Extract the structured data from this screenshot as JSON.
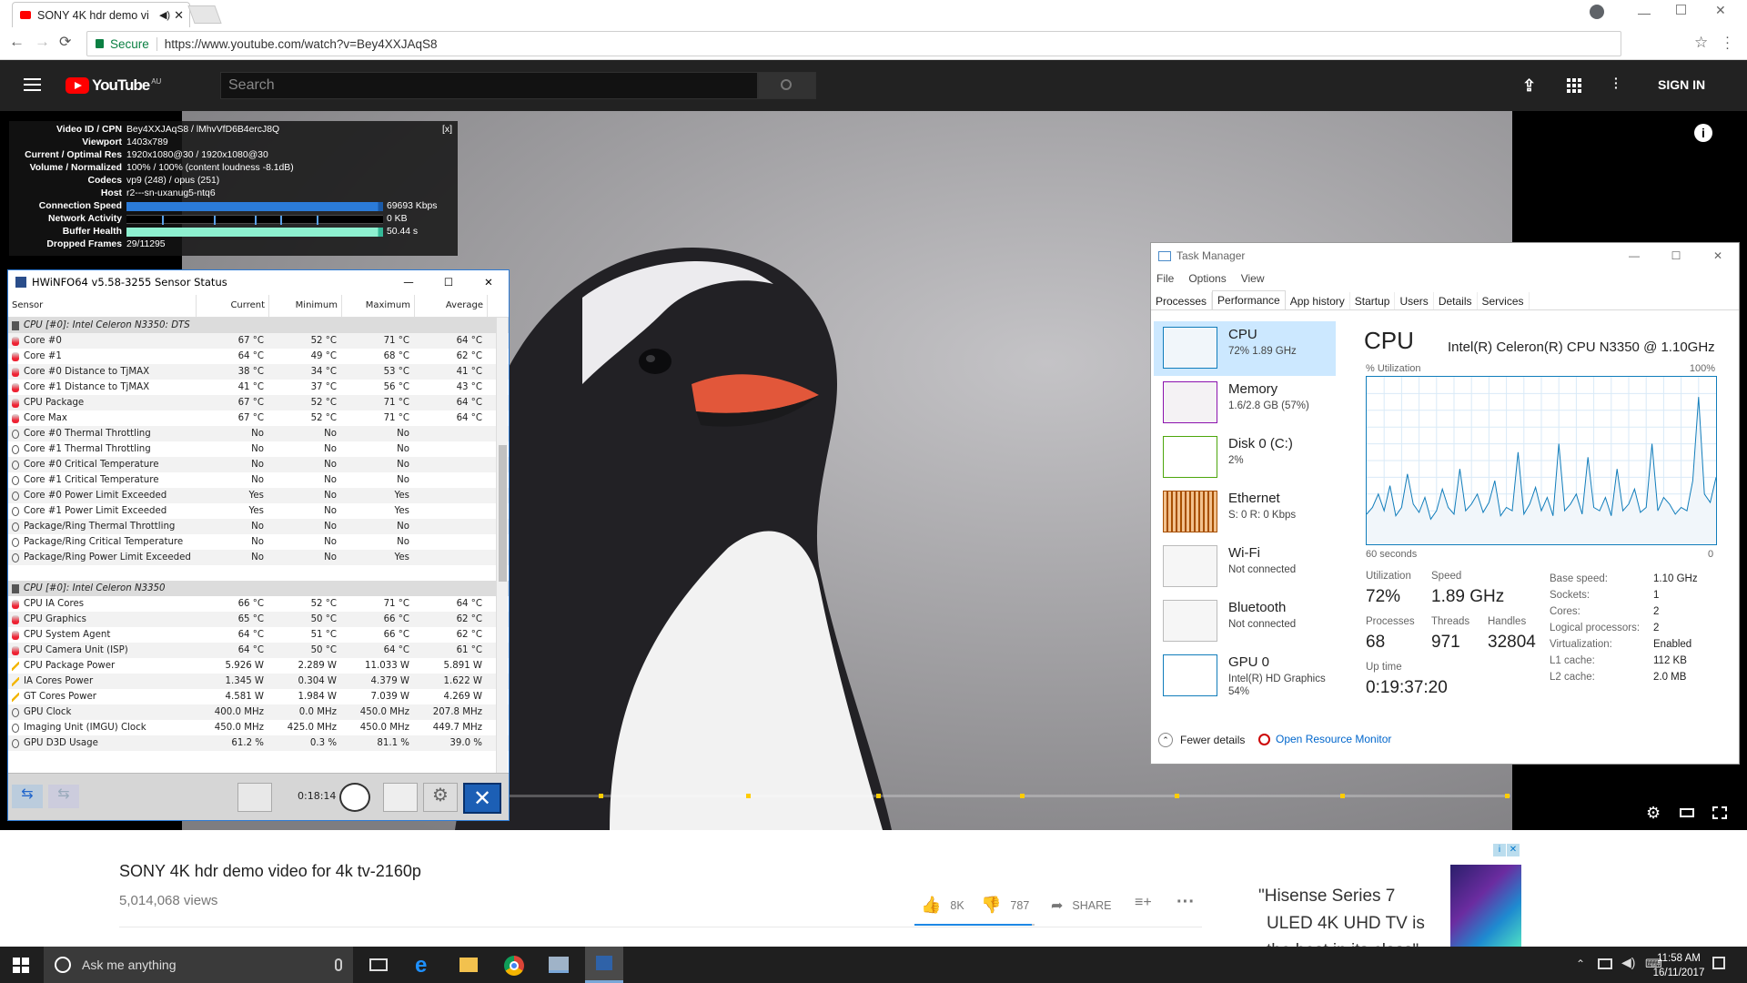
{
  "browser": {
    "tab_title": "SONY 4K hdr demo vi",
    "secure_label": "Secure",
    "url": "https://www.youtube.com/watch?v=Bey4XXJAqS8"
  },
  "youtube": {
    "logo_text": "YouTube",
    "logo_region": "AU",
    "search_placeholder": "Search",
    "sign_in": "SIGN IN",
    "video_title": "SONY 4K hdr demo video for 4k tv-2160p",
    "views": "5,014,068 views",
    "likes": "8K",
    "dislikes": "787",
    "share": "SHARE",
    "ad_text_1": "\"Hisense Series 7",
    "ad_text_2": "ULED 4K UHD TV is",
    "ad_text_3": "the best in its class\""
  },
  "stats_for_nerds": {
    "close": "[x]",
    "rows": [
      {
        "k": "Video ID / CPN",
        "v": "Bey4XXJAqS8 / lMhvVfD6B4ercJ8Q"
      },
      {
        "k": "Viewport",
        "v": "1403x789"
      },
      {
        "k": "Current / Optimal Res",
        "v": "1920x1080@30 / 1920x1080@30"
      },
      {
        "k": "Volume / Normalized",
        "v": "100% / 100% (content loudness -8.1dB)"
      },
      {
        "k": "Codecs",
        "v": "vp9 (248) / opus (251)"
      },
      {
        "k": "Host",
        "v": "r2---sn-uxanug5-ntq6"
      }
    ],
    "bars": [
      {
        "k": "Connection Speed",
        "v": "69693 Kbps"
      },
      {
        "k": "Network Activity",
        "v": "0 KB"
      },
      {
        "k": "Buffer Health",
        "v": "50.44 s"
      }
    ],
    "dropped_label": "Dropped Frames",
    "dropped_value": "29/11295"
  },
  "hwinfo": {
    "title": "HWiNFO64 v5.58-3255 Sensor Status",
    "headers": [
      "Sensor",
      "Current",
      "Minimum",
      "Maximum",
      "Average"
    ],
    "timer": "0:18:14",
    "rows": [
      {
        "t": "grp",
        "n": "CPU [#0]: Intel Celeron N3350: DTS"
      },
      {
        "t": "temp",
        "n": "Core #0",
        "c": "67 °C",
        "mi": "52 °C",
        "ma": "71 °C",
        "av": "64 °C"
      },
      {
        "t": "temp",
        "n": "Core #1",
        "c": "64 °C",
        "mi": "49 °C",
        "ma": "68 °C",
        "av": "62 °C"
      },
      {
        "t": "temp",
        "n": "Core #0 Distance to TjMAX",
        "c": "38 °C",
        "mi": "34 °C",
        "ma": "53 °C",
        "av": "41 °C"
      },
      {
        "t": "temp",
        "n": "Core #1 Distance to TjMAX",
        "c": "41 °C",
        "mi": "37 °C",
        "ma": "56 °C",
        "av": "43 °C"
      },
      {
        "t": "temp",
        "n": "CPU Package",
        "c": "67 °C",
        "mi": "52 °C",
        "ma": "71 °C",
        "av": "64 °C"
      },
      {
        "t": "temp",
        "n": "Core Max",
        "c": "67 °C",
        "mi": "52 °C",
        "ma": "71 °C",
        "av": "64 °C"
      },
      {
        "t": "bool",
        "n": "Core #0 Thermal Throttling",
        "c": "No",
        "mi": "No",
        "ma": "No",
        "av": ""
      },
      {
        "t": "bool",
        "n": "Core #1 Thermal Throttling",
        "c": "No",
        "mi": "No",
        "ma": "No",
        "av": ""
      },
      {
        "t": "bool",
        "n": "Core #0 Critical Temperature",
        "c": "No",
        "mi": "No",
        "ma": "No",
        "av": ""
      },
      {
        "t": "bool",
        "n": "Core #1 Critical Temperature",
        "c": "No",
        "mi": "No",
        "ma": "No",
        "av": ""
      },
      {
        "t": "bool",
        "n": "Core #0 Power Limit Exceeded",
        "c": "Yes",
        "mi": "No",
        "ma": "Yes",
        "av": ""
      },
      {
        "t": "bool",
        "n": "Core #1 Power Limit Exceeded",
        "c": "Yes",
        "mi": "No",
        "ma": "Yes",
        "av": ""
      },
      {
        "t": "bool",
        "n": "Package/Ring Thermal Throttling",
        "c": "No",
        "mi": "No",
        "ma": "No",
        "av": ""
      },
      {
        "t": "bool",
        "n": "Package/Ring Critical Temperature",
        "c": "No",
        "mi": "No",
        "ma": "No",
        "av": ""
      },
      {
        "t": "bool",
        "n": "Package/Ring Power Limit Exceeded",
        "c": "No",
        "mi": "No",
        "ma": "Yes",
        "av": ""
      },
      {
        "t": "blank",
        "n": ""
      },
      {
        "t": "grp",
        "n": "CPU [#0]: Intel Celeron N3350"
      },
      {
        "t": "temp",
        "n": "CPU IA Cores",
        "c": "66 °C",
        "mi": "52 °C",
        "ma": "71 °C",
        "av": "64 °C"
      },
      {
        "t": "temp",
        "n": "CPU Graphics",
        "c": "65 °C",
        "mi": "50 °C",
        "ma": "66 °C",
        "av": "62 °C"
      },
      {
        "t": "temp",
        "n": "CPU System Agent",
        "c": "64 °C",
        "mi": "51 °C",
        "ma": "66 °C",
        "av": "62 °C"
      },
      {
        "t": "temp",
        "n": "CPU Camera Unit (ISP)",
        "c": "64 °C",
        "mi": "50 °C",
        "ma": "64 °C",
        "av": "61 °C"
      },
      {
        "t": "power",
        "n": "CPU Package Power",
        "c": "5.926 W",
        "mi": "2.289 W",
        "ma": "11.033 W",
        "av": "5.891 W"
      },
      {
        "t": "power",
        "n": "IA Cores Power",
        "c": "1.345 W",
        "mi": "0.304 W",
        "ma": "4.379 W",
        "av": "1.622 W"
      },
      {
        "t": "power",
        "n": "GT Cores Power",
        "c": "4.581 W",
        "mi": "1.984 W",
        "ma": "7.039 W",
        "av": "4.269 W"
      },
      {
        "t": "bool",
        "n": "GPU Clock",
        "c": "400.0 MHz",
        "mi": "0.0 MHz",
        "ma": "450.0 MHz",
        "av": "207.8 MHz"
      },
      {
        "t": "bool",
        "n": "Imaging Unit (IMGU) Clock",
        "c": "450.0 MHz",
        "mi": "425.0 MHz",
        "ma": "450.0 MHz",
        "av": "449.7 MHz"
      },
      {
        "t": "bool",
        "n": "GPU D3D Usage",
        "c": "61.2 %",
        "mi": "0.3 %",
        "ma": "81.1 %",
        "av": "39.0 %"
      }
    ]
  },
  "taskmanager": {
    "title": "Task Manager",
    "menu": [
      "File",
      "Options",
      "View"
    ],
    "tabs": [
      "Processes",
      "Performance",
      "App history",
      "Startup",
      "Users",
      "Details",
      "Services"
    ],
    "resources": [
      {
        "name": "CPU",
        "sub": "72%  1.89 GHz",
        "sub2": ""
      },
      {
        "name": "Memory",
        "sub": "1.6/2.8 GB (57%)",
        "sub2": ""
      },
      {
        "name": "Disk 0 (C:)",
        "sub": "2%",
        "sub2": ""
      },
      {
        "name": "Ethernet",
        "sub": "S: 0  R: 0 Kbps",
        "sub2": ""
      },
      {
        "name": "Wi-Fi",
        "sub": "Not connected",
        "sub2": ""
      },
      {
        "name": "Bluetooth",
        "sub": "Not connected",
        "sub2": ""
      },
      {
        "name": "GPU 0",
        "sub": "Intel(R) HD Graphics",
        "sub2": "54%"
      }
    ],
    "heading": "CPU",
    "cpu_model": "Intel(R) Celeron(R) CPU N3350 @ 1.10GHz",
    "util_label": "% Utilization",
    "util_max": "100%",
    "time_label": "60 seconds",
    "zero": "0",
    "utilization_label": "Utilization",
    "utilization": "72%",
    "speed_label": "Speed",
    "speed": "1.89 GHz",
    "processes_label": "Processes",
    "processes": "68",
    "threads_label": "Threads",
    "threads": "971",
    "handles_label": "Handles",
    "handles": "32804",
    "uptime_label": "Up time",
    "uptime": "0:19:37:20",
    "specs": [
      {
        "k": "Base speed:",
        "v": "1.10 GHz"
      },
      {
        "k": "Sockets:",
        "v": "1"
      },
      {
        "k": "Cores:",
        "v": "2"
      },
      {
        "k": "Logical processors:",
        "v": "2"
      },
      {
        "k": "Virtualization:",
        "v": "Enabled"
      },
      {
        "k": "L1 cache:",
        "v": "112 KB"
      },
      {
        "k": "L2 cache:",
        "v": "2.0 MB"
      }
    ],
    "fewer_details": "Fewer details",
    "open_monitor": "Open Resource Monitor",
    "cpu_history": [
      18,
      22,
      30,
      20,
      35,
      17,
      22,
      42,
      24,
      19,
      28,
      15,
      20,
      33,
      22,
      18,
      45,
      20,
      24,
      30,
      19,
      25,
      38,
      17,
      22,
      20,
      55,
      18,
      24,
      34,
      20,
      28,
      17,
      60,
      20,
      24,
      30,
      18,
      52,
      22,
      20,
      28,
      17,
      45,
      20,
      24,
      33,
      19,
      22,
      60,
      20,
      28,
      24,
      18,
      22,
      20,
      38,
      88,
      30,
      25,
      40
    ]
  },
  "taskbar": {
    "search_text": "Ask me anything",
    "time": "11:58 AM",
    "date": "16/11/2017"
  },
  "colors": {
    "yt_red": "#ff0000",
    "cpu_blue": "#117dbb",
    "mem_purple": "#8b12ae",
    "disk_green": "#4da60c",
    "eth_orange": "#a74f01"
  }
}
